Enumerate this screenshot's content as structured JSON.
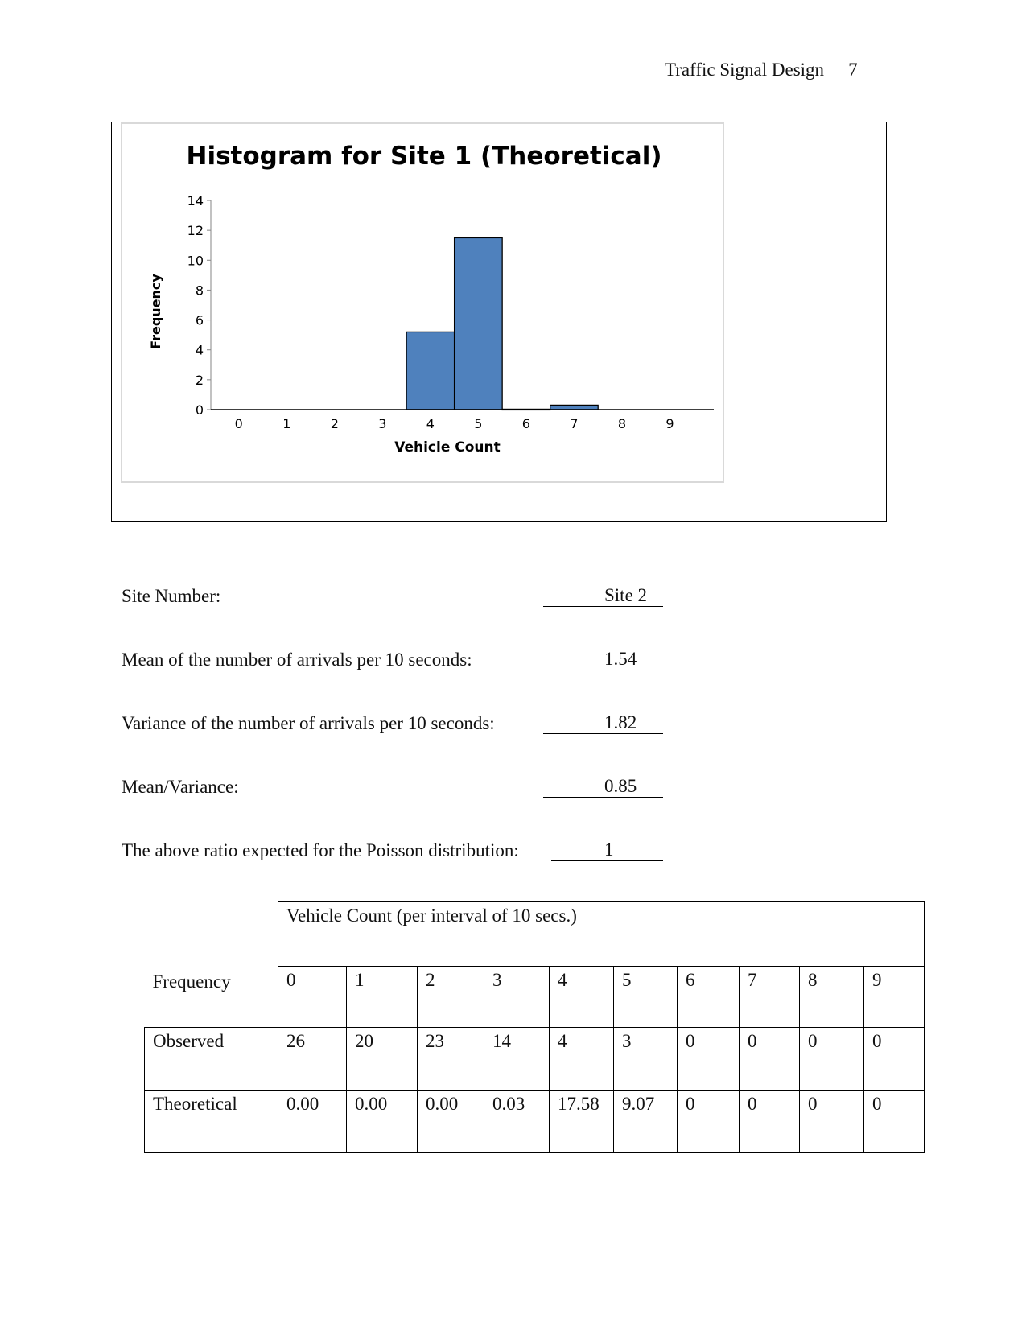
{
  "header": {
    "running_title": "Traffic Signal Design",
    "page_number": "7"
  },
  "chart_data": {
    "type": "bar",
    "title": "Histogram for Site 1 (Theoretical)",
    "xlabel": "Vehicle Count",
    "ylabel": "Frequency",
    "categories": [
      "0",
      "1",
      "2",
      "3",
      "4",
      "5",
      "6",
      "7",
      "8",
      "9"
    ],
    "values": [
      0,
      0,
      0,
      0,
      5.2,
      11.5,
      0.03,
      0.3,
      0,
      0
    ],
    "ylim": [
      0,
      14
    ],
    "yticks": [
      0,
      2,
      4,
      6,
      8,
      10,
      12,
      14
    ],
    "grid": false,
    "legend": "none",
    "bar_color": "#4f81bd",
    "bar_edge_color": "#000000"
  },
  "fields": [
    {
      "label": "Site Number:",
      "value": "Site 2"
    },
    {
      "label": "Mean of the number of arrivals per 10 seconds:",
      "value": "1.54"
    },
    {
      "label": "Variance of the number of arrivals per 10 seconds:",
      "value": "1.82"
    },
    {
      "label": "Mean/Variance:",
      "value": "0.85"
    },
    {
      "label": "The above ratio expected for the Poisson distribution:",
      "value": "1"
    }
  ],
  "table": {
    "group_header": "Vehicle Count (per interval of 10 secs.)",
    "row_header_label": "Frequency",
    "columns": [
      "0",
      "1",
      "2",
      "3",
      "4",
      "5",
      "6",
      "7",
      "8",
      "9"
    ],
    "rows": [
      {
        "label": "Observed",
        "values": [
          "26",
          "20",
          "23",
          "14",
          "4",
          "3",
          "0",
          "0",
          "0",
          "0"
        ]
      },
      {
        "label": "Theoretical",
        "values": [
          "0.00",
          "0.00",
          "0.00",
          "0.03",
          "17.58",
          "9.07",
          "0",
          "0",
          "0",
          "0"
        ]
      }
    ]
  }
}
